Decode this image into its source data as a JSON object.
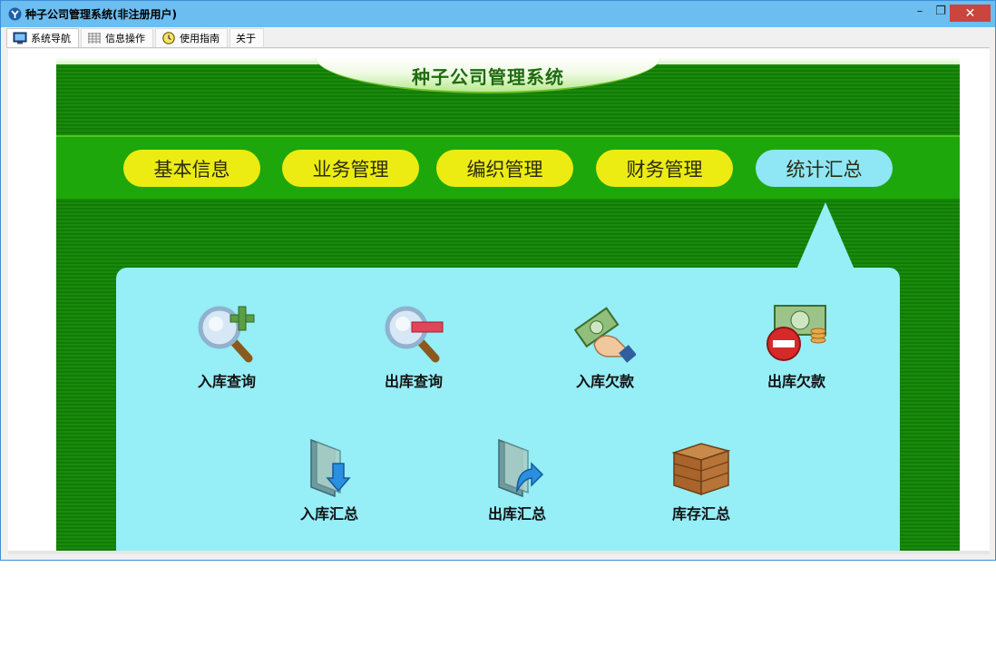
{
  "window": {
    "title": "种子公司管理系统(非注册用户)",
    "controls": {
      "minimize": "–",
      "maximize": "❐",
      "close": "✕"
    }
  },
  "tabs": [
    {
      "label": "系统导航",
      "icon": "monitor-icon"
    },
    {
      "label": "信息操作",
      "icon": "grid-icon"
    },
    {
      "label": "使用指南",
      "icon": "clock-icon"
    },
    {
      "label": "关于",
      "icon": ""
    }
  ],
  "banner": {
    "title": "种子公司管理系统"
  },
  "nav": {
    "items": [
      "基本信息",
      "业务管理",
      "编织管理",
      "财务管理",
      "统计汇总"
    ],
    "active": "统计汇总"
  },
  "tiles": [
    {
      "label": "入库查询",
      "icon": "magnifier-plus-icon"
    },
    {
      "label": "出库查询",
      "icon": "magnifier-minus-icon"
    },
    {
      "label": "入库欠款",
      "icon": "hand-money-icon"
    },
    {
      "label": "出库欠款",
      "icon": "money-minus-icon"
    },
    {
      "label": "入库汇总",
      "icon": "folder-down-icon"
    },
    {
      "label": "出库汇总",
      "icon": "folder-out-icon"
    },
    {
      "label": "库存汇总",
      "icon": "crate-icon"
    }
  ],
  "colors": {
    "titlebar": "#6cbdf0",
    "panel_green": "#1a8a0c",
    "nav_band": "#1ea70a",
    "pill_yellow": "#ecec12",
    "pill_active": "#8fe6f5",
    "content_bg": "#96eef7",
    "close_button": "#c9453d"
  }
}
